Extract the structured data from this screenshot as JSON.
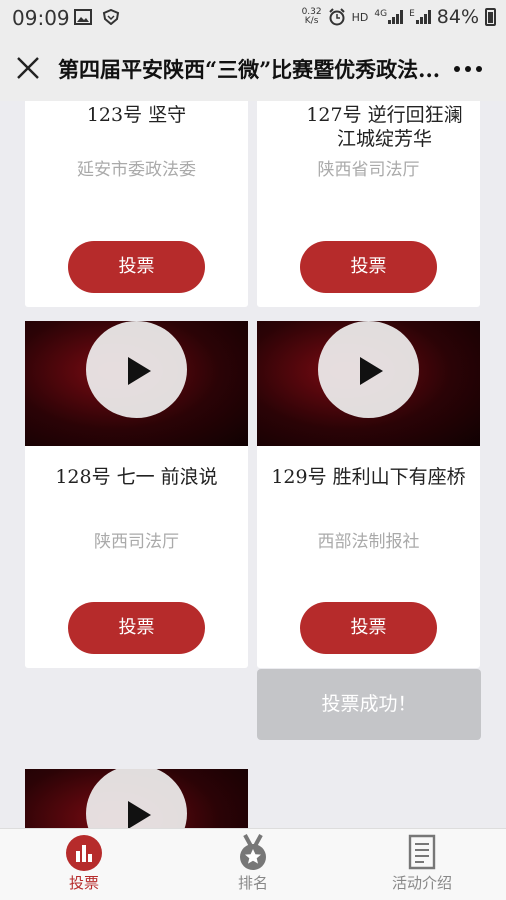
{
  "status_bar": {
    "time": "09:09",
    "net_speed_value": "0.32",
    "net_speed_unit": "K/s",
    "hd": "HD",
    "network": "4G",
    "network2": "E",
    "battery": "84%"
  },
  "nav": {
    "title": "第四届平安陕西“三微”比赛暨优秀政法...",
    "close_icon": "close-icon",
    "more_icon": "more-dots-icon"
  },
  "cards": [
    {
      "name": "123号 坚守",
      "org": "延安市委政法委",
      "vote_label": "投票",
      "has_thumb": false
    },
    {
      "name": "127号 逆行回狂澜江城绽芳华",
      "org": "陕西省司法厅",
      "vote_label": "投票",
      "has_thumb": false
    },
    {
      "name": "128号 七一 前浪说",
      "org": "陕西司法厅",
      "vote_label": "投票",
      "has_thumb": true
    },
    {
      "name": "129号 胜利山下有座桥",
      "org": "西部法制报社",
      "vote_label": "投票",
      "has_thumb": true
    },
    {
      "has_thumb": true
    }
  ],
  "success_message": "投票成功！",
  "tabs": [
    {
      "label": "投票",
      "icon": "bar-chart-icon",
      "active": true
    },
    {
      "label": "排名",
      "icon": "medal-icon",
      "active": false
    },
    {
      "label": "活动介绍",
      "icon": "document-icon",
      "active": false
    }
  ],
  "colors": {
    "accent": "#b62b2b",
    "success_bg": "#c4c5c8"
  }
}
